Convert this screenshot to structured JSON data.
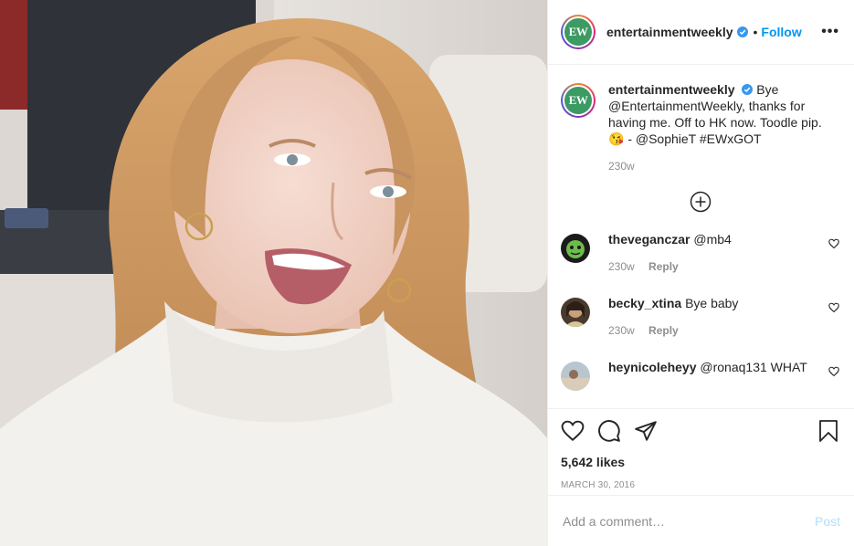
{
  "post": {
    "photo_alt": "Selfie of a smiling woman with long strawberry blonde hair in a white turtleneck sweater, seated on a plane",
    "author": {
      "username": "entertainmentweekly",
      "avatar_initials": "EW",
      "verified": true
    },
    "follow_dot": "•",
    "follow_label": "Follow",
    "more_label": "•••",
    "caption": {
      "username": "entertainmentweekly",
      "text": "Bye @EntertainmentWeekly, thanks for having me. Off to HK now. Toodle pip. 😘 - @SophieT #EWxGOT",
      "time": "230w"
    },
    "comments": [
      {
        "username": "theveganczar",
        "text": "@mb4",
        "time": "230w",
        "reply_label": "Reply"
      },
      {
        "username": "becky_xtina",
        "text": "Bye baby",
        "time": "230w",
        "reply_label": "Reply"
      },
      {
        "username": "heynicoleheyy",
        "text": "@ronaq131 WHAT",
        "time": "",
        "reply_label": ""
      }
    ],
    "likes": "5,642 likes",
    "date": "MARCH 30, 2016",
    "comment_placeholder": "Add a comment…",
    "post_label": "Post"
  },
  "colors": {
    "link": "#0095f6",
    "ew_green": "#3c9a63",
    "muted": "#8e8e8e",
    "post_disabled": "#b2dffc"
  }
}
